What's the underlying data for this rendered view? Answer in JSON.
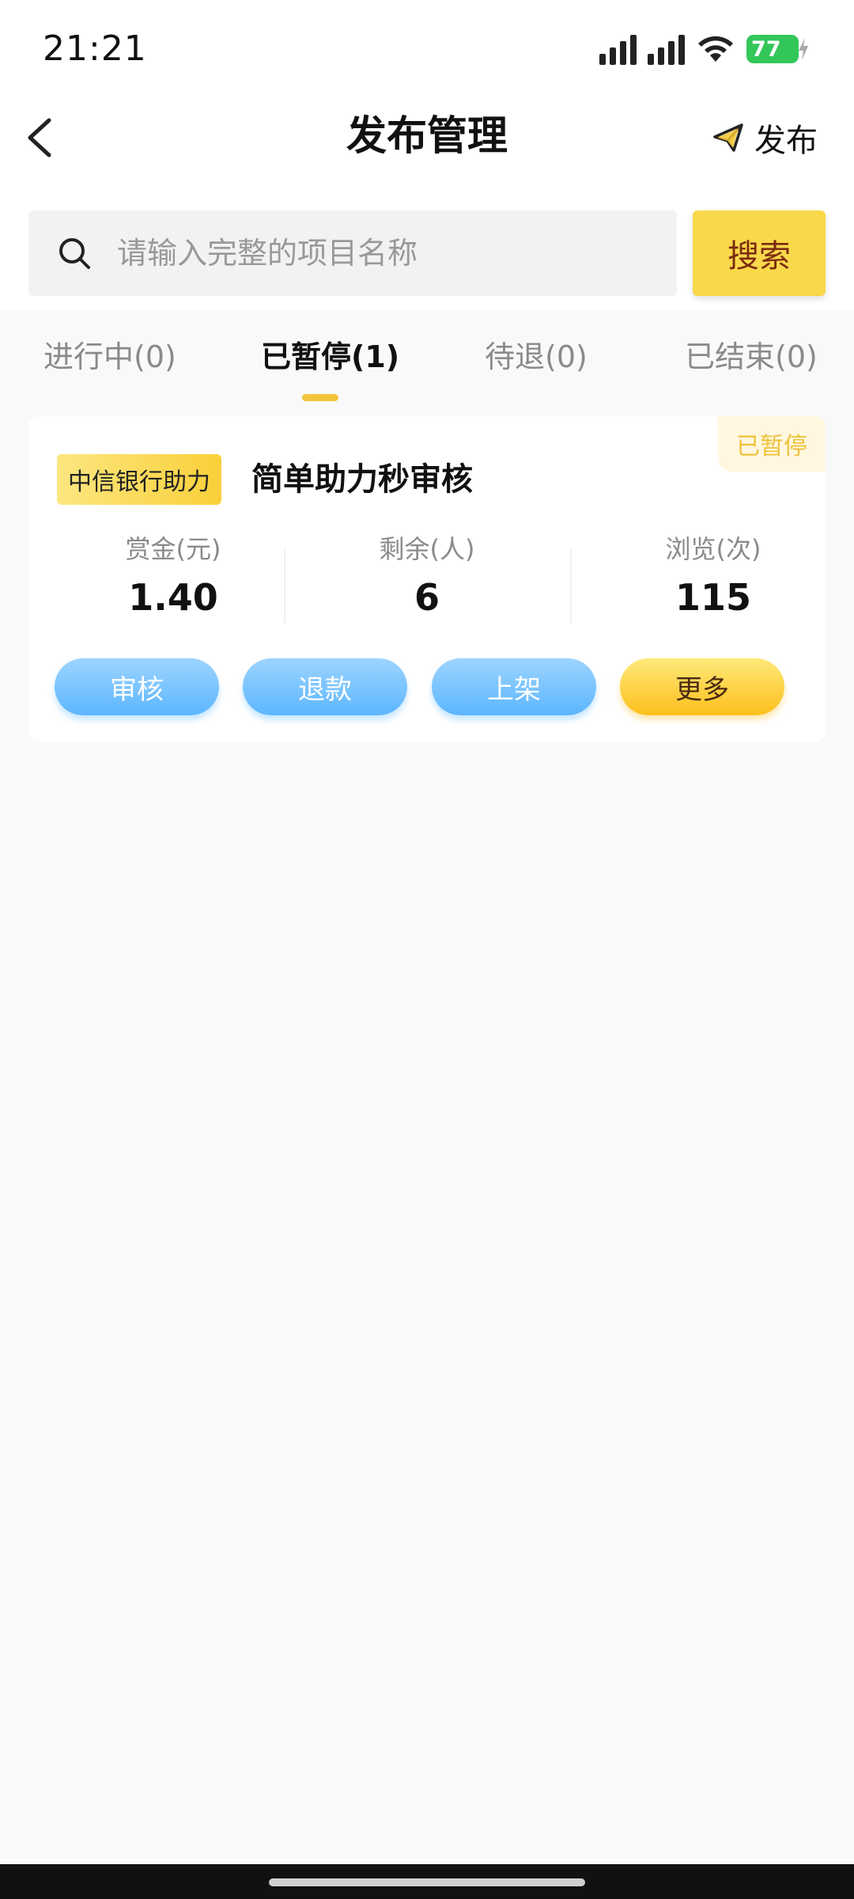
{
  "status_bar": {
    "time": "21:21",
    "battery": "77"
  },
  "header": {
    "title": "发布管理",
    "publish_label": "发布"
  },
  "search": {
    "placeholder": "请输入完整的项目名称",
    "button_label": "搜索"
  },
  "tabs": [
    {
      "label": "进行中(0)",
      "active": false
    },
    {
      "label": "已暂停(1)",
      "active": true
    },
    {
      "label": "待退(0)",
      "active": false
    },
    {
      "label": "已结束(0)",
      "active": false
    }
  ],
  "cards": [
    {
      "status": "已暂停",
      "tag": "中信银行助力",
      "title": "简单助力秒审核",
      "stats": [
        {
          "label": "赏金(元)",
          "value": "1.40"
        },
        {
          "label": "剩余(人)",
          "value": "6"
        },
        {
          "label": "浏览(次)",
          "value": "115"
        }
      ],
      "actions": [
        "审核",
        "退款",
        "上架",
        "更多"
      ]
    }
  ]
}
